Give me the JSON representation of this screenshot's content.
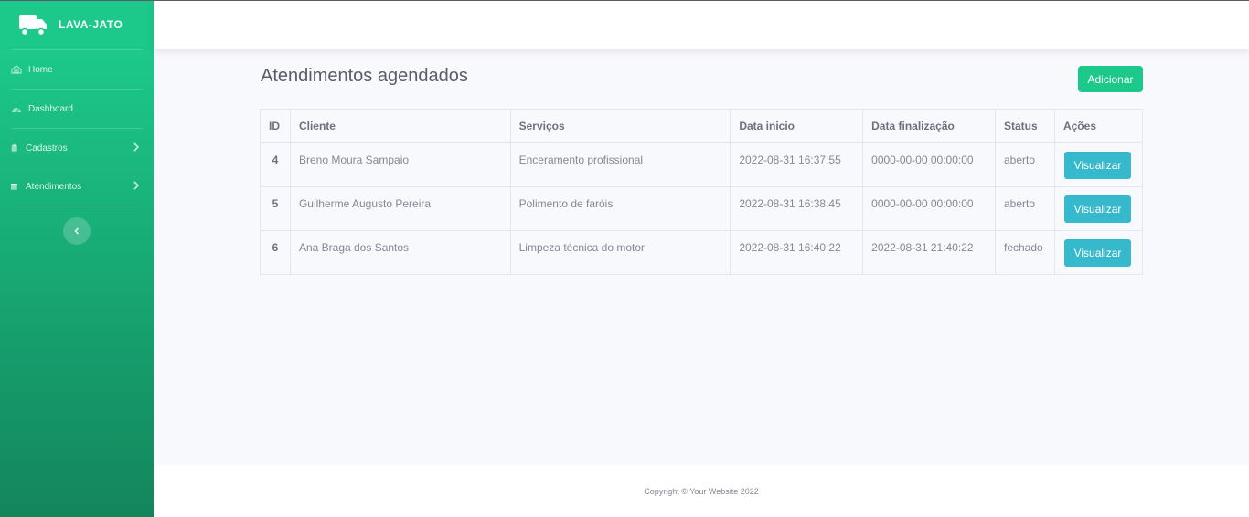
{
  "brand": {
    "name": "LAVA-JATO",
    "icon": "truck-icon"
  },
  "sidebar": {
    "items": [
      {
        "label": "Home",
        "icon": "home-icon"
      },
      {
        "label": "Dashboard",
        "icon": "dashboard-icon"
      },
      {
        "label": "Cadastros",
        "icon": "clipboard-icon",
        "has_submenu": true
      },
      {
        "label": "Atendimentos",
        "icon": "calendar-icon",
        "has_submenu": true
      }
    ],
    "toggle_icon": "chevron-left-icon"
  },
  "main": {
    "title": "Atendimentos agendados",
    "add_label": "Adicionar",
    "table": {
      "headers": [
        "ID",
        "Cliente",
        "Serviços",
        "Data inicio",
        "Data finalização",
        "Status",
        "Ações"
      ],
      "rows": [
        {
          "id": "4",
          "cliente": "Breno Moura Sampaio",
          "servicos": "Enceramento profissional",
          "inicio": "2022-08-31 16:37:55",
          "fim": "0000-00-00 00:00:00",
          "status": "aberto",
          "action": "Visualizar"
        },
        {
          "id": "5",
          "cliente": "Guilherme Augusto Pereira",
          "servicos": "Polimento de faróis",
          "inicio": "2022-08-31 16:38:45",
          "fim": "0000-00-00 00:00:00",
          "status": "aberto",
          "action": "Visualizar"
        },
        {
          "id": "6",
          "cliente": "Ana Braga dos Santos",
          "servicos": "Limpeza técnica do motor",
          "inicio": "2022-08-31 16:40:22",
          "fim": "2022-08-31 21:40:22",
          "status": "fechado",
          "action": "Visualizar"
        }
      ]
    }
  },
  "footer": {
    "text": "Copyright © Your Website 2022"
  },
  "colors": {
    "primary": "#1cc88a",
    "info": "#36b9cc",
    "sidebar_end": "#13855c"
  }
}
